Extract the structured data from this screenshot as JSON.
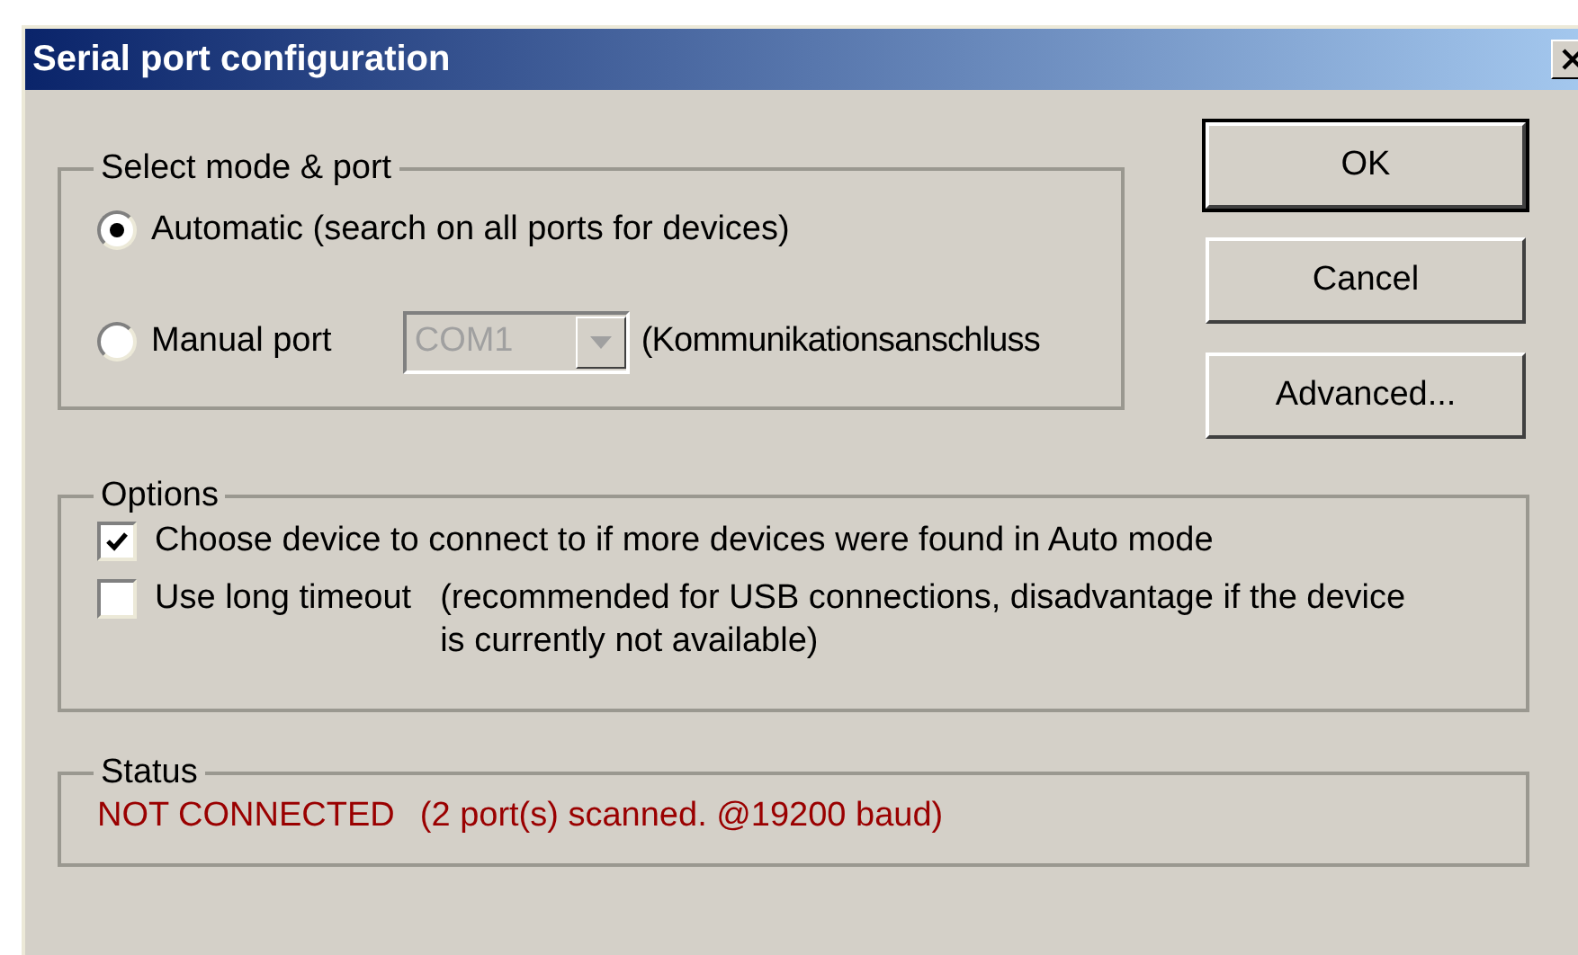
{
  "window": {
    "title": "Serial port configuration"
  },
  "mode_group": {
    "label": "Select mode & port",
    "options": [
      {
        "label": "Automatic (search on all ports for devices)",
        "selected": true
      },
      {
        "label": "Manual port",
        "selected": false,
        "port": {
          "value": "COM1",
          "disabled": true
        },
        "note": "(Kommunikationsanschluss"
      }
    ]
  },
  "buttons": [
    {
      "label": "OK",
      "default": true
    },
    {
      "label": "Cancel",
      "default": false
    },
    {
      "label": "Advanced...",
      "default": false
    }
  ],
  "options": {
    "label": "Options",
    "items": [
      {
        "label": "Choose device to connect to if more devices were found in Auto mode",
        "checked": true
      },
      {
        "label": "Use long timeout",
        "checked": false,
        "note": "(recommended for USB connections, disadvantage if the device is currently not available)"
      }
    ]
  },
  "status": {
    "label": "Status",
    "state": "NOT CONNECTED",
    "detail": "(2 port(s) scanned. @19200 baud)"
  }
}
